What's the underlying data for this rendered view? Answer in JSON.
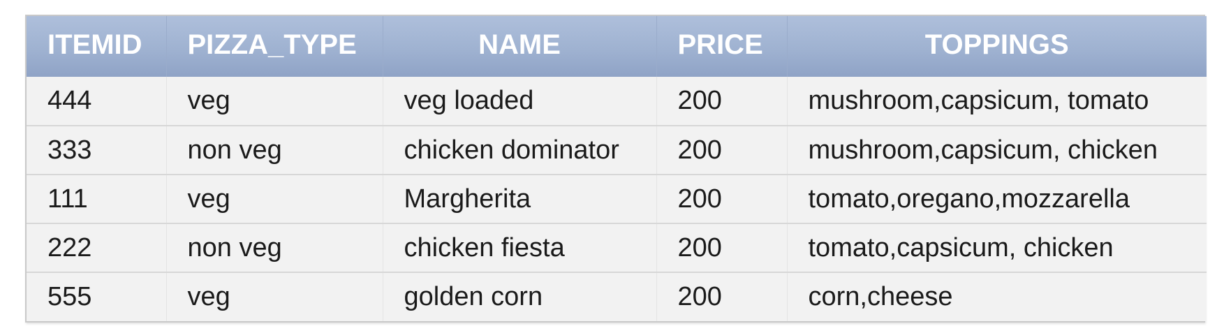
{
  "table": {
    "columns": [
      "ITEMID",
      "PIZZA_TYPE",
      "NAME",
      "PRICE",
      "TOPPINGS"
    ],
    "rows": [
      [
        "444",
        "veg",
        "veg loaded",
        "200",
        "mushroom,capsicum, tomato"
      ],
      [
        "333",
        "non veg",
        "chicken dominator",
        "200",
        "mushroom,capsicum, chicken"
      ],
      [
        "111",
        "veg",
        "Margherita",
        "200",
        "tomato,oregano,mozzarella"
      ],
      [
        "222",
        "non veg",
        "chicken fiesta",
        "200",
        "tomato,capsicum, chicken"
      ],
      [
        "555",
        "veg",
        "golden corn",
        "200",
        "corn,cheese"
      ]
    ]
  },
  "colors": {
    "header_top": "#aebfdb",
    "header_bottom": "#8fa3c6",
    "header_text": "#ffffff",
    "row_bg": "#f2f2f2",
    "row_border": "#d7d7d7"
  }
}
